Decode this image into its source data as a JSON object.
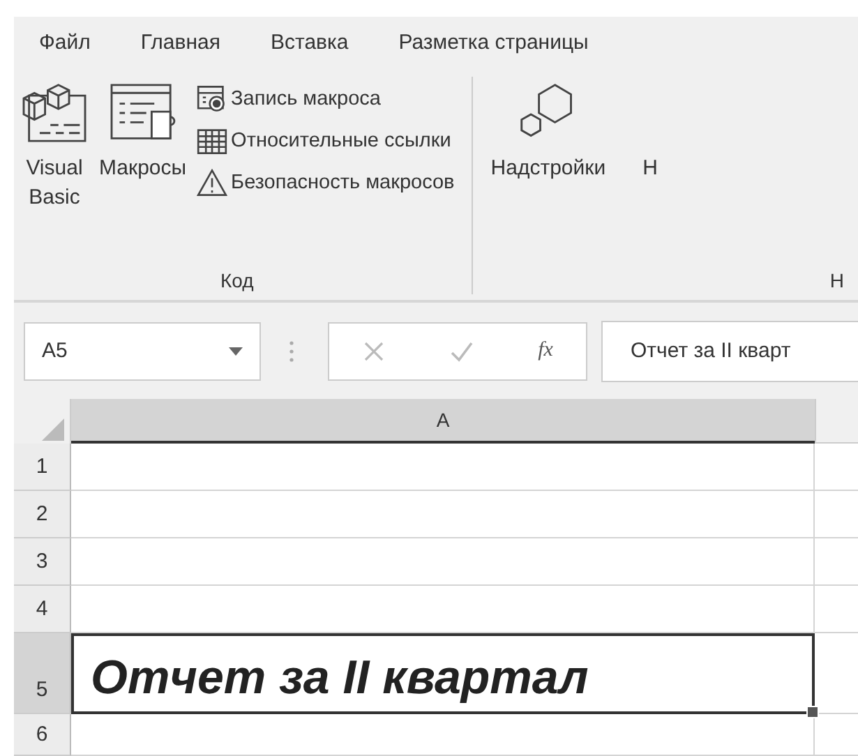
{
  "tabs": [
    {
      "label": "Файл",
      "selected": false
    },
    {
      "label": "Главная",
      "selected": false
    },
    {
      "label": "Вставка",
      "selected": false
    },
    {
      "label": "Разметка страницы",
      "selected": false
    }
  ],
  "ribbon_groups": [
    {
      "label": "Код",
      "buttons": [
        {
          "kind": "large",
          "label_lines": [
            "Visual",
            "Basic"
          ]
        },
        {
          "kind": "large",
          "label_lines": [
            "Макросы"
          ]
        },
        {
          "kind": "stack",
          "items": [
            {
              "label": "Запись макроса"
            },
            {
              "label": "Относительные ссылки"
            },
            {
              "label": "Безопасность макросов"
            }
          ]
        }
      ]
    },
    {
      "label": "Н",
      "buttons": [
        {
          "kind": "large",
          "label_lines": [
            "Надстройки"
          ]
        },
        {
          "kind": "large",
          "label_lines": [
            "Н"
          ]
        }
      ]
    }
  ],
  "formula_bar": {
    "name_box": "A5",
    "function_label": "fx",
    "value": "Отчет за II кварт"
  },
  "sheet": {
    "columns": [
      {
        "label": "A",
        "selected": true
      }
    ],
    "rows": [
      {
        "number": "1",
        "selected": false
      },
      {
        "number": "2",
        "selected": false
      },
      {
        "number": "3",
        "selected": false
      },
      {
        "number": "4",
        "selected": false
      },
      {
        "number": "5",
        "selected": true,
        "value": "Отчет за II квартал"
      },
      {
        "number": "6",
        "selected": false
      }
    ]
  }
}
